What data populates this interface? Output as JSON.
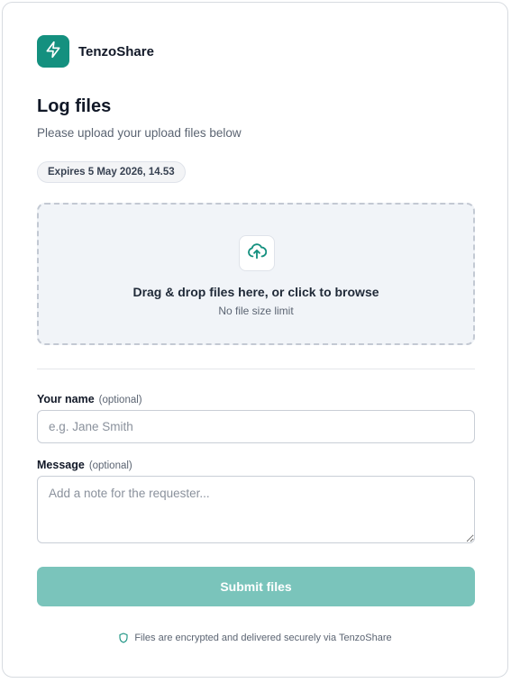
{
  "brand": {
    "name": "TenzoShare",
    "accent_color": "#14907f",
    "logo_icon": "lightning-bolt-icon"
  },
  "page": {
    "title": "Log files",
    "subtitle": "Please upload your upload files below",
    "expiry_badge": "Expires 5 May 2026, 14.53"
  },
  "dropzone": {
    "icon": "cloud-upload-icon",
    "title": "Drag & drop files here, or click to browse",
    "subtitle": "No file size limit"
  },
  "form": {
    "name_label": "Your name",
    "name_optional": "(optional)",
    "name_placeholder": "e.g. Jane Smith",
    "name_value": "",
    "message_label": "Message",
    "message_optional": "(optional)",
    "message_placeholder": "Add a note for the requester...",
    "message_value": "",
    "submit_label": "Submit files",
    "submit_color": "#7ac4bb"
  },
  "footer": {
    "icon": "shield-icon",
    "note": "Files are encrypted and delivered securely via TenzoShare"
  }
}
